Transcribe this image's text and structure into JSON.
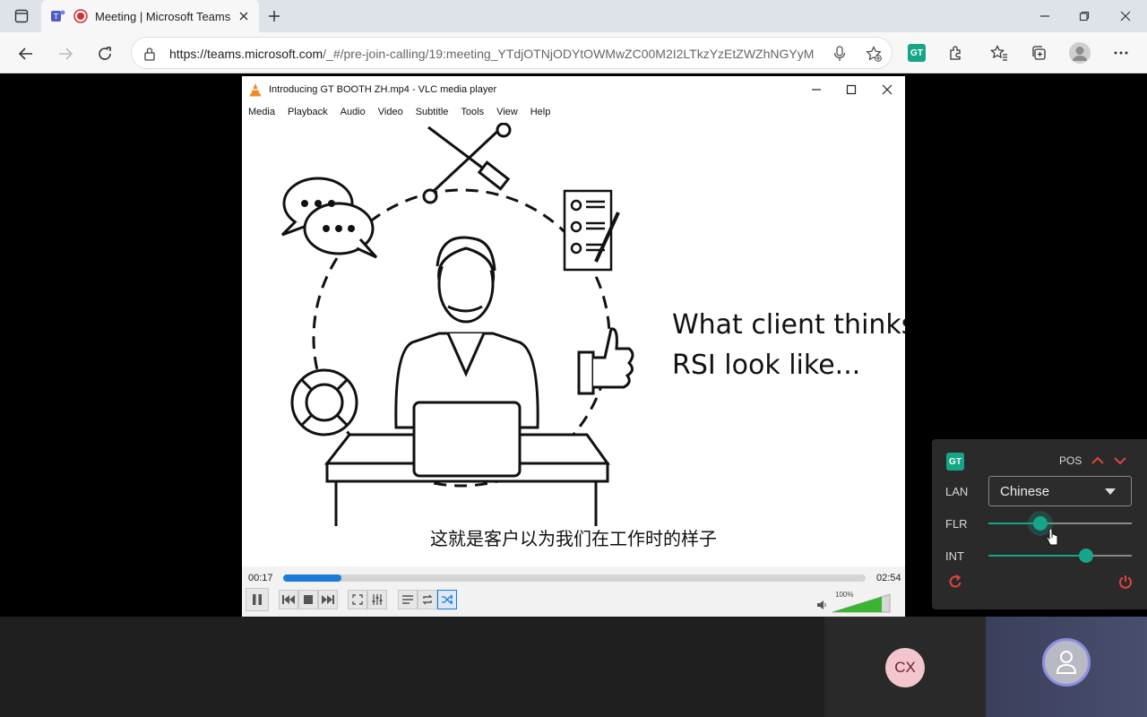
{
  "browser": {
    "tab_title": "Meeting | Microsoft Teams",
    "url_host": "https://teams.microsoft.com",
    "url_path": "/_#/pre-join-calling/19:meeting_YTdjOTNjODYtOWMwZC00M2I2LTkzYzEtZWZhNGYyM...",
    "gt_ext_label": "GT"
  },
  "vlc": {
    "title": "Introducing GT BOOTH ZH.mp4 - VLC media player",
    "menu": [
      "Media",
      "Playback",
      "Audio",
      "Video",
      "Subtitle",
      "Tools",
      "View",
      "Help"
    ],
    "video_caption_line1": "What client thinks",
    "video_caption_line2": "RSI look like...",
    "subtitle": "这就是客户以为我们在工作时的样子",
    "elapsed": "00:17",
    "duration": "02:54",
    "progress_fraction": 0.1,
    "volume_label": "100%",
    "volume_fraction": 1.0
  },
  "gt_panel": {
    "logo": "GT",
    "pos_label": "POS",
    "lan_label": "LAN",
    "language": "Chinese",
    "flr_label": "FLR",
    "flr_value": 0.36,
    "int_label": "INT",
    "int_value": 0.68
  },
  "participants": {
    "cx_initials": "CX"
  },
  "colors": {
    "accent_green": "#17a588",
    "gt_red": "#e0453a",
    "vlc_seek": "#1b7dd6"
  }
}
